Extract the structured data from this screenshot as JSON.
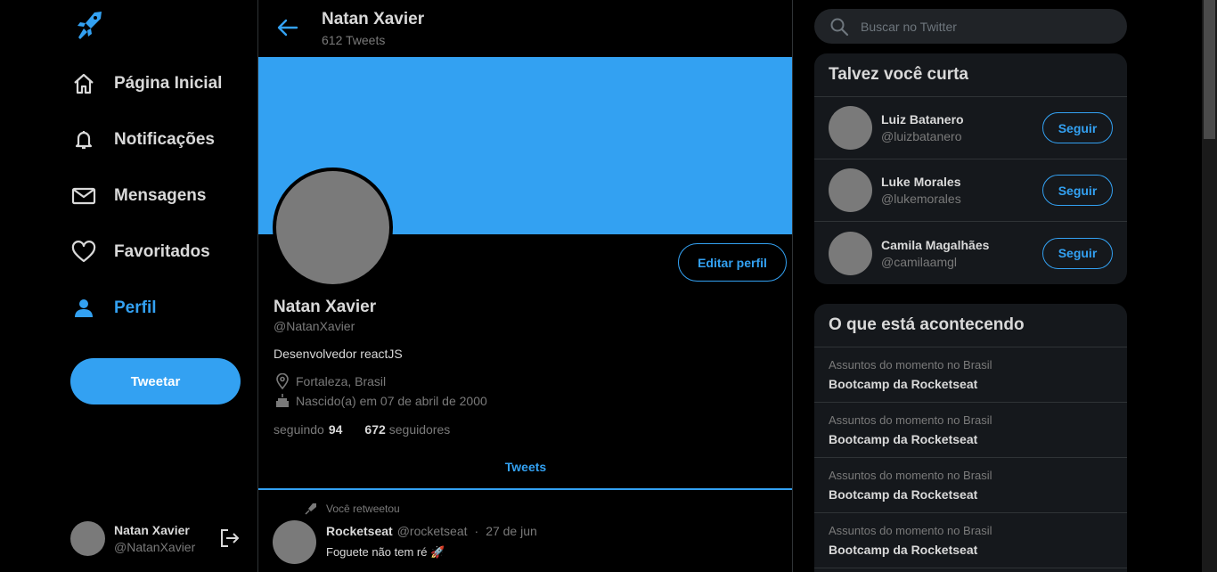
{
  "nav": {
    "items": [
      {
        "label": "Página Inicial",
        "icon": "home-icon"
      },
      {
        "label": "Notificações",
        "icon": "bell-icon"
      },
      {
        "label": "Mensagens",
        "icon": "mail-icon"
      },
      {
        "label": "Favoritados",
        "icon": "heart-icon"
      },
      {
        "label": "Perfil",
        "icon": "person-icon"
      }
    ],
    "tweet_label": "Tweetar",
    "user": {
      "name": "Natan Xavier",
      "handle": "@NatanXavier"
    }
  },
  "header": {
    "title": "Natan Xavier",
    "subtitle": "612 Tweets"
  },
  "profile": {
    "edit_label": "Editar perfil",
    "name": "Natan Xavier",
    "handle": "@NatanXavier",
    "bio": "Desenvolvedor reactJS",
    "location": "Fortaleza, Brasil",
    "birth": "Nascido(a) em 07 de abril de 2000",
    "following_label": "seguindo",
    "following_count": "94",
    "followers_count": "672",
    "followers_label": "seguidores"
  },
  "tabs": {
    "tweets": "Tweets"
  },
  "tweet": {
    "retweet_label": "Você retweetou",
    "author": "Rocketseat",
    "handle": "@rocketseat",
    "separator": "·",
    "date": "27 de jun",
    "text": "Foguete não tem ré 🚀"
  },
  "search": {
    "placeholder": "Buscar no Twitter"
  },
  "suggestions": {
    "title": "Talvez você curta",
    "follow_label": "Seguir",
    "users": [
      {
        "name": "Luiz Batanero",
        "handle": "@luizbatanero"
      },
      {
        "name": "Luke Morales",
        "handle": "@lukemorales"
      },
      {
        "name": "Camila Magalhães",
        "handle": "@camilaamgl"
      }
    ]
  },
  "trends": {
    "title": "O que está acontecendo",
    "items": [
      {
        "context": "Assuntos do momento no Brasil",
        "topic": "Bootcamp da Rocketseat"
      },
      {
        "context": "Assuntos do momento no Brasil",
        "topic": "Bootcamp da Rocketseat"
      },
      {
        "context": "Assuntos do momento no Brasil",
        "topic": "Bootcamp da Rocketseat"
      },
      {
        "context": "Assuntos do momento no Brasil",
        "topic": "Bootcamp da Rocketseat"
      }
    ]
  },
  "colors": {
    "accent": "#33a1f2",
    "background": "#000000",
    "card": "#15181c",
    "muted": "#7a7a7a"
  }
}
